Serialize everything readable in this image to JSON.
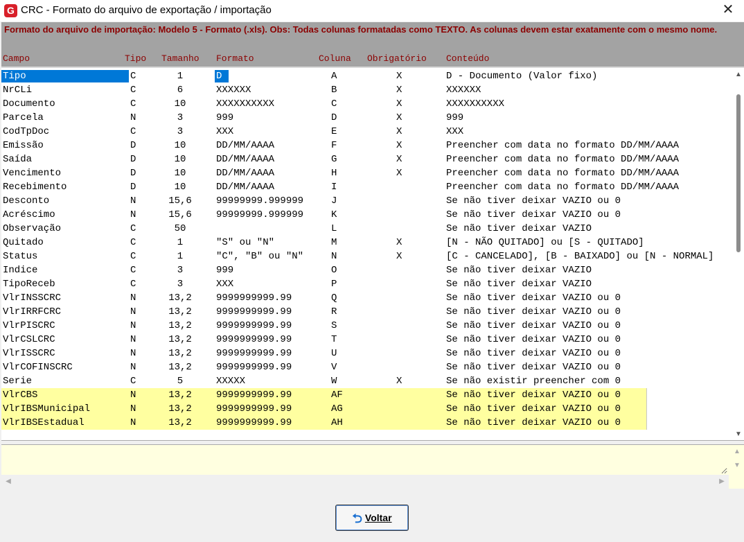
{
  "window": {
    "title": "CRC - Formato do arquivo de exportação / importação",
    "app_icon_letter": "G",
    "close_glyph": "✕"
  },
  "header": {
    "note": "Formato do arquivo de importação: Modelo 5 - Formato (.xls). Obs: Todas colunas formatadas como TEXTO. As colunas devem estar exatamente com o mesmo nome.",
    "columns": {
      "campo": "Campo",
      "tipo": "Tipo",
      "tamanho": "Tamanho",
      "formato": "Formato",
      "coluna": "Coluna",
      "obrigatorio": "Obrigatório",
      "conteudo": "Conteúdo"
    }
  },
  "rows": [
    {
      "campo": "Tipo",
      "tipo": "C",
      "tamanho": "1",
      "formato": "D",
      "coluna": "A",
      "obrigatorio": "X",
      "conteudo": "D - Documento (Valor fixo)"
    },
    {
      "campo": "NrCLi",
      "tipo": "C",
      "tamanho": "6",
      "formato": "XXXXXX",
      "coluna": "B",
      "obrigatorio": "X",
      "conteudo": "XXXXXX"
    },
    {
      "campo": "Documento",
      "tipo": "C",
      "tamanho": "10",
      "formato": "XXXXXXXXXX",
      "coluna": "C",
      "obrigatorio": "X",
      "conteudo": "XXXXXXXXXX"
    },
    {
      "campo": "Parcela",
      "tipo": "N",
      "tamanho": "3",
      "formato": "999",
      "coluna": "D",
      "obrigatorio": "X",
      "conteudo": "999"
    },
    {
      "campo": "CodTpDoc",
      "tipo": "C",
      "tamanho": "3",
      "formato": "XXX",
      "coluna": "E",
      "obrigatorio": "X",
      "conteudo": "XXX"
    },
    {
      "campo": "Emissão",
      "tipo": "D",
      "tamanho": "10",
      "formato": "DD/MM/AAAA",
      "coluna": "F",
      "obrigatorio": "X",
      "conteudo": "Preencher com data no formato DD/MM/AAAA"
    },
    {
      "campo": "Saída",
      "tipo": "D",
      "tamanho": "10",
      "formato": "DD/MM/AAAA",
      "coluna": "G",
      "obrigatorio": "X",
      "conteudo": "Preencher com data no formato DD/MM/AAAA"
    },
    {
      "campo": "Vencimento",
      "tipo": "D",
      "tamanho": "10",
      "formato": "DD/MM/AAAA",
      "coluna": "H",
      "obrigatorio": "X",
      "conteudo": "Preencher com data no formato DD/MM/AAAA"
    },
    {
      "campo": "Recebimento",
      "tipo": "D",
      "tamanho": "10",
      "formato": "DD/MM/AAAA",
      "coluna": "I",
      "obrigatorio": "",
      "conteudo": "Preencher com data no formato DD/MM/AAAA"
    },
    {
      "campo": "Desconto",
      "tipo": "N",
      "tamanho": "15,6",
      "formato": "99999999.999999",
      "coluna": "J",
      "obrigatorio": "",
      "conteudo": "Se não tiver deixar VAZIO ou 0"
    },
    {
      "campo": "Acréscimo",
      "tipo": "N",
      "tamanho": "15,6",
      "formato": "99999999.999999",
      "coluna": "K",
      "obrigatorio": "",
      "conteudo": "Se não tiver deixar VAZIO ou 0"
    },
    {
      "campo": "Observação",
      "tipo": "C",
      "tamanho": "50",
      "formato": "",
      "coluna": "L",
      "obrigatorio": "",
      "conteudo": "Se não tiver deixar VAZIO"
    },
    {
      "campo": "Quitado",
      "tipo": "C",
      "tamanho": "1",
      "formato": "\"S\" ou \"N\"",
      "coluna": "M",
      "obrigatorio": "X",
      "conteudo": "[N - NÃO QUITADO] ou [S - QUITADO]"
    },
    {
      "campo": "Status",
      "tipo": "C",
      "tamanho": "1",
      "formato": "\"C\", \"B\" ou \"N\"",
      "coluna": "N",
      "obrigatorio": "X",
      "conteudo": "[C - CANCELADO], [B - BAIXADO] ou [N - NORMAL]"
    },
    {
      "campo": "Indice",
      "tipo": "C",
      "tamanho": "3",
      "formato": "999",
      "coluna": "O",
      "obrigatorio": "",
      "conteudo": "Se não tiver deixar VAZIO"
    },
    {
      "campo": "TipoReceb",
      "tipo": "C",
      "tamanho": "3",
      "formato": "XXX",
      "coluna": "P",
      "obrigatorio": "",
      "conteudo": "Se não tiver deixar VAZIO"
    },
    {
      "campo": "VlrINSSCRC",
      "tipo": "N",
      "tamanho": "13,2",
      "formato": "9999999999.99",
      "coluna": "Q",
      "obrigatorio": "",
      "conteudo": "Se não tiver deixar VAZIO ou 0"
    },
    {
      "campo": "VlrIRRFCRC",
      "tipo": "N",
      "tamanho": "13,2",
      "formato": "9999999999.99",
      "coluna": "R",
      "obrigatorio": "",
      "conteudo": "Se não tiver deixar VAZIO ou 0"
    },
    {
      "campo": "VlrPISCRC",
      "tipo": "N",
      "tamanho": "13,2",
      "formato": "9999999999.99",
      "coluna": "S",
      "obrigatorio": "",
      "conteudo": "Se não tiver deixar VAZIO ou 0"
    },
    {
      "campo": "VlrCSLCRC",
      "tipo": "N",
      "tamanho": "13,2",
      "formato": "9999999999.99",
      "coluna": "T",
      "obrigatorio": "",
      "conteudo": "Se não tiver deixar VAZIO ou 0"
    },
    {
      "campo": "VlrISSCRC",
      "tipo": "N",
      "tamanho": "13,2",
      "formato": "9999999999.99",
      "coluna": "U",
      "obrigatorio": "",
      "conteudo": "Se não tiver deixar VAZIO ou 0"
    },
    {
      "campo": "VlrCOFINSCRC",
      "tipo": "N",
      "tamanho": "13,2",
      "formato": "9999999999.99",
      "coluna": "V",
      "obrigatorio": "",
      "conteudo": "Se não tiver deixar VAZIO ou 0"
    },
    {
      "campo": "Serie",
      "tipo": "C",
      "tamanho": "5",
      "formato": "XXXXX",
      "coluna": "W",
      "obrigatorio": "X",
      "conteudo": "Se não existir preencher com 0"
    },
    {
      "campo": "VlrCBS",
      "tipo": "N",
      "tamanho": "13,2",
      "formato": "9999999999.99",
      "coluna": "AF",
      "obrigatorio": "",
      "conteudo": "Se não tiver deixar VAZIO ou 0",
      "highlight": true
    },
    {
      "campo": "VlrIBSMunicipal",
      "tipo": "N",
      "tamanho": "13,2",
      "formato": "9999999999.99",
      "coluna": "AG",
      "obrigatorio": "",
      "conteudo": "Se não tiver deixar VAZIO ou 0",
      "highlight": true
    },
    {
      "campo": "VlrIBSEstadual",
      "tipo": "N",
      "tamanho": "13,2",
      "formato": "9999999999.99",
      "coluna": "AH",
      "obrigatorio": "",
      "conteudo": "Se não tiver deixar VAZIO ou 0",
      "highlight": true
    }
  ],
  "memo": {
    "value": ""
  },
  "footer": {
    "voltar_label": "Voltar"
  },
  "colors": {
    "header_bg": "#a3a3a3",
    "header_text": "#8b0000",
    "selection": "#0078d7",
    "highlight_row": "#ffffa0",
    "memo_bg": "#ffffe0"
  }
}
